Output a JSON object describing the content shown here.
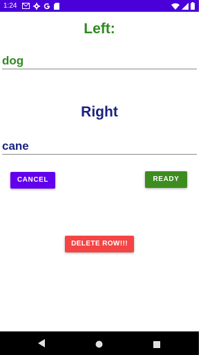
{
  "status_bar": {
    "time": "1:24",
    "color": "#4a00d9",
    "left_icons": [
      "mail-icon",
      "settings-icon",
      "google-icon",
      "sd-card-icon"
    ],
    "right_icons": [
      "wifi-icon",
      "cell-signal-icon",
      "battery-icon"
    ]
  },
  "left_section": {
    "heading": "Left:",
    "value": "dog",
    "color": "#2e8b1f"
  },
  "right_section": {
    "heading": "Right",
    "value": "cane",
    "color": "#1a237e"
  },
  "buttons": {
    "cancel": "CANCEL",
    "ready": "READY",
    "delete_row": "DELETE ROW!!!"
  },
  "colors": {
    "cancel": "#6200ee",
    "ready": "#3d8c20",
    "delete": "#f44444"
  },
  "nav_bar": {
    "icons": [
      "back-icon",
      "home-icon",
      "recents-icon"
    ]
  }
}
